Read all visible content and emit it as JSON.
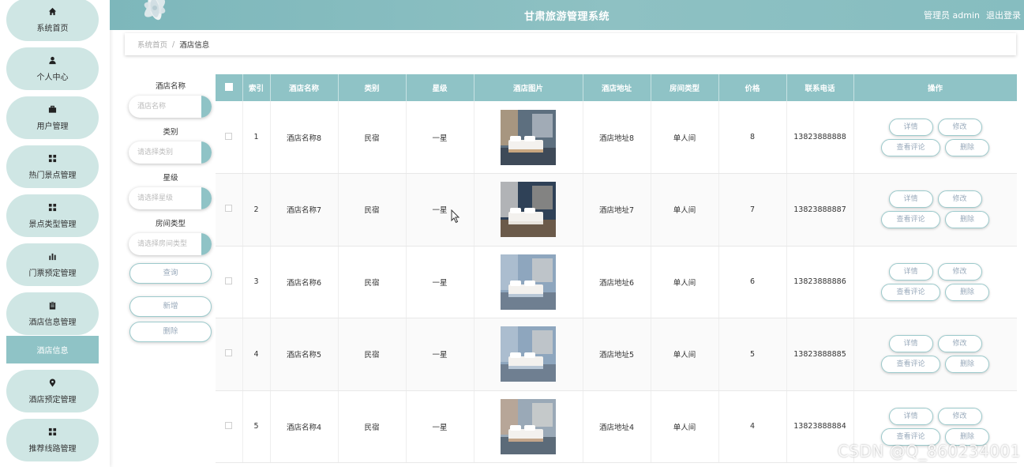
{
  "header": {
    "title": "甘肃旅游管理系统",
    "user": "管理员 admin",
    "logout": "退出登录"
  },
  "sidebar": {
    "items": [
      {
        "label": "系统首页",
        "icon": "home-icon"
      },
      {
        "label": "个人中心",
        "icon": "user-icon"
      },
      {
        "label": "用户管理",
        "icon": "briefcase-icon"
      },
      {
        "label": "热门景点管理",
        "icon": "grid-icon"
      },
      {
        "label": "景点类型管理",
        "icon": "grid-icon"
      },
      {
        "label": "门票预定管理",
        "icon": "bar-chart-icon"
      },
      {
        "label": "酒店信息管理",
        "icon": "clipboard-icon"
      },
      {
        "label": "酒店预定管理",
        "icon": "map-pin-icon"
      },
      {
        "label": "推荐线路管理",
        "icon": "grid-icon"
      }
    ],
    "active_sub": "酒店信息"
  },
  "breadcrumb": {
    "home": "系统首页",
    "separator": "/",
    "current": "酒店信息"
  },
  "filters": {
    "name_label": "酒店名称",
    "name_placeholder": "酒店名称",
    "type_label": "类别",
    "type_placeholder": "请选择类别",
    "star_label": "星级",
    "star_placeholder": "请选择星级",
    "room_label": "房间类型",
    "room_placeholder": "请选择房间类型",
    "search_button": "查询",
    "add_button": "新增",
    "delete_button": "删除"
  },
  "table": {
    "columns": [
      "",
      "索引",
      "酒店名称",
      "类别",
      "星级",
      "酒店图片",
      "酒店地址",
      "房间类型",
      "价格",
      "联系电话",
      "操作"
    ],
    "rows": [
      {
        "index": "1",
        "name": "酒店名称8",
        "type": "民宿",
        "star": "一星",
        "address": "酒店地址8",
        "room": "单人间",
        "price": "8",
        "phone": "13823888888",
        "img": "img-1"
      },
      {
        "index": "2",
        "name": "酒店名称7",
        "type": "民宿",
        "star": "一星",
        "address": "酒店地址7",
        "room": "单人间",
        "price": "7",
        "phone": "13823888887",
        "img": "img-2"
      },
      {
        "index": "3",
        "name": "酒店名称6",
        "type": "民宿",
        "star": "一星",
        "address": "酒店地址6",
        "room": "单人间",
        "price": "6",
        "phone": "13823888886",
        "img": "img-3"
      },
      {
        "index": "4",
        "name": "酒店名称5",
        "type": "民宿",
        "star": "一星",
        "address": "酒店地址5",
        "room": "单人间",
        "price": "5",
        "phone": "13823888885",
        "img": "img-4"
      },
      {
        "index": "5",
        "name": "酒店名称4",
        "type": "民宿",
        "star": "一星",
        "address": "酒店地址4",
        "room": "单人间",
        "price": "4",
        "phone": "13823888884",
        "img": "img-5"
      }
    ],
    "actions": {
      "detail": "详情",
      "edit": "修改",
      "reviews": "查看评论",
      "delete": "删除"
    }
  },
  "watermark": "CSDN @Q_860234001",
  "colors": {
    "accent": "#8fc3c6",
    "nav_bg": "#cfe6e4",
    "header_bg": "#86bdc0"
  }
}
